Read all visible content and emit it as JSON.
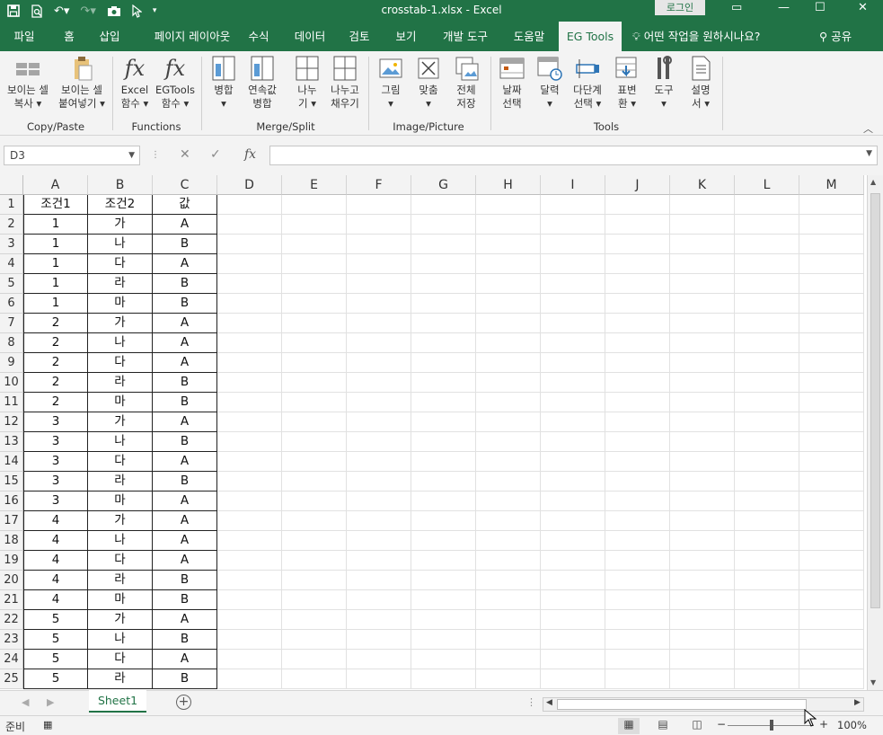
{
  "app": {
    "title": "crosstab-1.xlsx  -  Excel",
    "login": "로그인"
  },
  "qat": {
    "icons": [
      "save-icon",
      "print-preview-icon",
      "undo-icon",
      "redo-icon",
      "camera-icon",
      "pointer-icon",
      "customize-icon"
    ]
  },
  "menu": {
    "tabs": [
      "파일",
      "홈",
      "삽입",
      "페이지 레이아웃",
      "수식",
      "데이터",
      "검토",
      "보기",
      "개발 도구",
      "도움말",
      "EG Tools"
    ],
    "active": "EG Tools",
    "tell_me": "어떤 작업을 원하시나요?",
    "share": "공유"
  },
  "ribbon": {
    "buttons": [
      {
        "line1": "보이는 셀",
        "line2": "복사 ▾",
        "icon": "visible-copy-icon"
      },
      {
        "line1": "보이는 셀",
        "line2": "붙여넣기 ▾",
        "icon": "visible-paste-icon"
      },
      {
        "line1": "Excel",
        "line2": "함수 ▾",
        "icon": "fx-icon"
      },
      {
        "line1": "EGTools",
        "line2": "함수 ▾",
        "icon": "fx-icon"
      },
      {
        "line1": "병합",
        "line2": "▾",
        "icon": "merge-icon"
      },
      {
        "line1": "연속값",
        "line2": "병합",
        "icon": "merge-continuous-icon"
      },
      {
        "line1": "나누",
        "line2": "기 ▾",
        "icon": "split-icon"
      },
      {
        "line1": "나누고",
        "line2": "채우기",
        "icon": "split-fill-icon"
      },
      {
        "line1": "그림",
        "line2": "▾",
        "icon": "picture-icon"
      },
      {
        "line1": "맞춤",
        "line2": "▾",
        "icon": "fit-icon"
      },
      {
        "line1": "전체",
        "line2": "저장",
        "icon": "save-all-icon"
      },
      {
        "line1": "날짜",
        "line2": "선택",
        "icon": "date-picker-icon"
      },
      {
        "line1": "달력",
        "line2": "▾",
        "icon": "calendar-icon"
      },
      {
        "line1": "다단계",
        "line2": "선택 ▾",
        "icon": "multilevel-select-icon"
      },
      {
        "line1": "표변",
        "line2": "환 ▾",
        "icon": "table-transform-icon"
      },
      {
        "line1": "도구",
        "line2": "▾",
        "icon": "tools-icon"
      },
      {
        "line1": "설명",
        "line2": "서 ▾",
        "icon": "manual-icon"
      }
    ],
    "groups": [
      "Copy/Paste",
      "Functions",
      "Merge/Split",
      "Image/Picture",
      "Tools"
    ]
  },
  "formula_bar": {
    "name_box": "D3",
    "fx_label": "fx",
    "formula": ""
  },
  "sheet": {
    "columns": [
      "A",
      "B",
      "C",
      "D",
      "E",
      "F",
      "G",
      "H",
      "I",
      "J",
      "K",
      "L",
      "M"
    ],
    "rows": [
      "1",
      "2",
      "3",
      "4",
      "5",
      "6",
      "7",
      "8",
      "9",
      "10",
      "11",
      "12",
      "13",
      "14",
      "15",
      "16",
      "17",
      "18",
      "19",
      "20",
      "21",
      "22",
      "23",
      "24",
      "25"
    ],
    "data": [
      [
        "조건1",
        "조건2",
        "값"
      ],
      [
        "1",
        "가",
        "A"
      ],
      [
        "1",
        "나",
        "B"
      ],
      [
        "1",
        "다",
        "A"
      ],
      [
        "1",
        "라",
        "B"
      ],
      [
        "1",
        "마",
        "B"
      ],
      [
        "2",
        "가",
        "A"
      ],
      [
        "2",
        "나",
        "A"
      ],
      [
        "2",
        "다",
        "A"
      ],
      [
        "2",
        "라",
        "B"
      ],
      [
        "2",
        "마",
        "B"
      ],
      [
        "3",
        "가",
        "A"
      ],
      [
        "3",
        "나",
        "B"
      ],
      [
        "3",
        "다",
        "A"
      ],
      [
        "3",
        "라",
        "B"
      ],
      [
        "3",
        "마",
        "A"
      ],
      [
        "4",
        "가",
        "A"
      ],
      [
        "4",
        "나",
        "A"
      ],
      [
        "4",
        "다",
        "A"
      ],
      [
        "4",
        "라",
        "B"
      ],
      [
        "4",
        "마",
        "B"
      ],
      [
        "5",
        "가",
        "A"
      ],
      [
        "5",
        "나",
        "B"
      ],
      [
        "5",
        "다",
        "A"
      ],
      [
        "5",
        "라",
        "B"
      ]
    ]
  },
  "sheet_tabs": {
    "tabs": [
      "Sheet1"
    ],
    "active": "Sheet1"
  },
  "status": {
    "ready": "준비",
    "zoom": "100%"
  },
  "colors": {
    "accent": "#217346",
    "ribbon_bg": "#f3f3f3"
  }
}
